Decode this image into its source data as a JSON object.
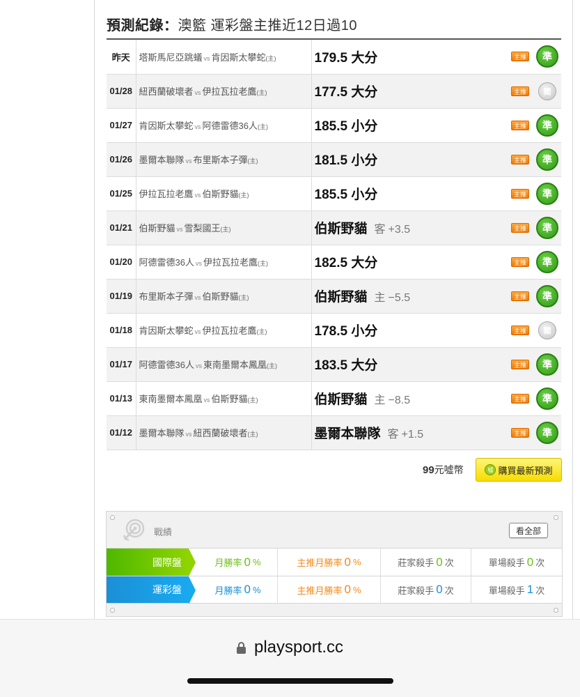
{
  "page_title": {
    "label": "預測紀錄：",
    "text": "澳籃 運彩盤主推近12日過10"
  },
  "records": [
    {
      "date": "昨天",
      "away": "塔斯馬尼亞跳蟻",
      "vs": "vs",
      "home": "肯因斯太攀蛇",
      "home_tag": "(主)",
      "pick": "179.5 大分",
      "side": "",
      "line": "",
      "badge": "主推",
      "result": "準",
      "result_type": "win"
    },
    {
      "date": "01/28",
      "away": "紐西蘭破壞者",
      "vs": "vs",
      "home": "伊拉瓦拉老鷹",
      "home_tag": "(主)",
      "pick": "177.5 大分",
      "side": "",
      "line": "",
      "badge": "主推",
      "result": "閻",
      "result_type": "push"
    },
    {
      "date": "01/27",
      "away": "肯因斯太攀蛇",
      "vs": "vs",
      "home": "阿德雷德36人",
      "home_tag": "(主)",
      "pick": "185.5 小分",
      "side": "",
      "line": "",
      "badge": "主推",
      "result": "準",
      "result_type": "win"
    },
    {
      "date": "01/26",
      "away": "墨爾本聯隊",
      "vs": "vs",
      "home": "布里斯本子彈",
      "home_tag": "(主)",
      "pick": "181.5 小分",
      "side": "",
      "line": "",
      "badge": "主推",
      "result": "準",
      "result_type": "win"
    },
    {
      "date": "01/25",
      "away": "伊拉瓦拉老鷹",
      "vs": "vs",
      "home": "伯斯野貓",
      "home_tag": "(主)",
      "pick": "185.5 小分",
      "side": "",
      "line": "",
      "badge": "主推",
      "result": "準",
      "result_type": "win"
    },
    {
      "date": "01/21",
      "away": "伯斯野貓",
      "vs": "vs",
      "home": "雪梨國王",
      "home_tag": "(主)",
      "pick": "伯斯野貓",
      "side": "客",
      "line": "+3.5",
      "badge": "主推",
      "result": "準",
      "result_type": "win"
    },
    {
      "date": "01/20",
      "away": "阿德雷德36人",
      "vs": "vs",
      "home": "伊拉瓦拉老鷹",
      "home_tag": "(主)",
      "pick": "182.5 大分",
      "side": "",
      "line": "",
      "badge": "主推",
      "result": "準",
      "result_type": "win"
    },
    {
      "date": "01/19",
      "away": "布里斯本子彈",
      "vs": "vs",
      "home": "伯斯野貓",
      "home_tag": "(主)",
      "pick": "伯斯野貓",
      "side": "主",
      "line": "−5.5",
      "badge": "主推",
      "result": "準",
      "result_type": "win"
    },
    {
      "date": "01/18",
      "away": "肯因斯太攀蛇",
      "vs": "vs",
      "home": "伊拉瓦拉老鷹",
      "home_tag": "(主)",
      "pick": "178.5 小分",
      "side": "",
      "line": "",
      "badge": "主推",
      "result": "閻",
      "result_type": "push"
    },
    {
      "date": "01/17",
      "away": "阿德雷德36人",
      "vs": "vs",
      "home": "東南墨爾本鳳凰",
      "home_tag": "(主)",
      "pick": "183.5 大分",
      "side": "",
      "line": "",
      "badge": "主推",
      "result": "準",
      "result_type": "win"
    },
    {
      "date": "01/13",
      "away": "東南墨爾本鳳凰",
      "vs": "vs",
      "home": "伯斯野貓",
      "home_tag": "(主)",
      "pick": "伯斯野貓",
      "side": "主",
      "line": "−8.5",
      "badge": "主推",
      "result": "準",
      "result_type": "win"
    },
    {
      "date": "01/12",
      "away": "墨爾本聯隊",
      "vs": "vs",
      "home": "紐西蘭破壞者",
      "home_tag": "(主)",
      "pick": "墨爾本聯隊",
      "side": "客",
      "line": "+1.5",
      "badge": "主推",
      "result": "準",
      "result_type": "win"
    }
  ],
  "purchase": {
    "price_value": "99",
    "price_unit": "元噓幣",
    "button_icon": "噓",
    "button_label": "購買最新預測"
  },
  "performance": {
    "title": "戰績",
    "view_all": "看全部",
    "rows": [
      {
        "label": "國際盤",
        "color": "#6bbf1a",
        "c1_label": "月勝率",
        "c1_value": "0",
        "c1_unit": "%",
        "c2_label": "主推月勝率",
        "c2_value": "0",
        "c2_unit": "%",
        "c3_label": "莊家殺手",
        "c3_value": "0",
        "c3_unit": "次",
        "c4_label": "單場殺手",
        "c4_value": "0",
        "c4_unit": "次"
      },
      {
        "label": "運彩盤",
        "color": "#1b8fd6",
        "c1_label": "月勝率",
        "c1_value": "0",
        "c1_unit": "%",
        "c2_label": "主推月勝率",
        "c2_value": "0",
        "c2_unit": "%",
        "c3_label": "莊家殺手",
        "c3_value": "0",
        "c3_unit": "次",
        "c4_label": "單場殺手",
        "c4_value": "1",
        "c4_unit": "次"
      }
    ]
  },
  "browser": {
    "url": "playsport.cc",
    "lock_icon": "lock-icon"
  }
}
